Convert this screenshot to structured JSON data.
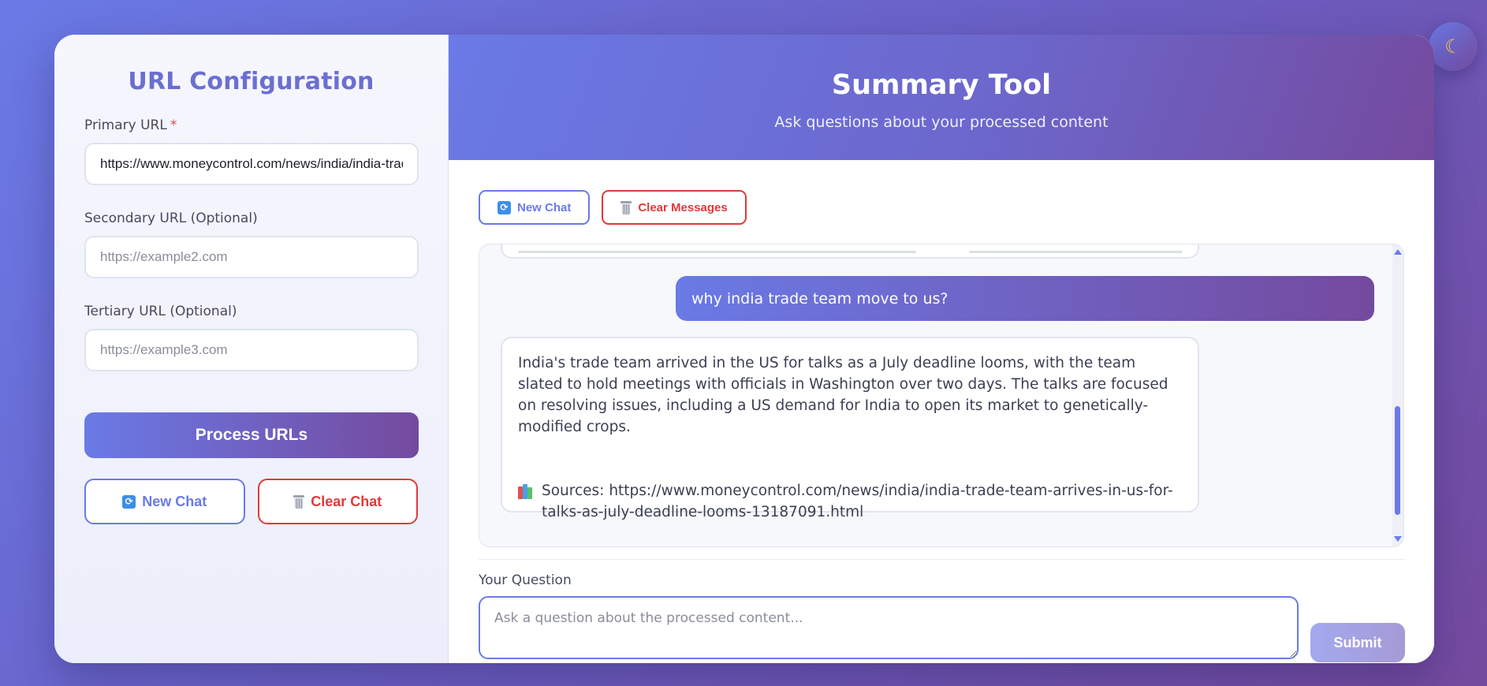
{
  "sidebar": {
    "title": "URL Configuration",
    "primary": {
      "label": "Primary URL",
      "required_mark": "*",
      "value": "https://www.moneycontrol.com/news/india/india-trade-team-arrives-in-us-for-talks-as-july-deadline-looms-13187091.html",
      "placeholder": ""
    },
    "secondary": {
      "label": "Secondary URL (Optional)",
      "value": "",
      "placeholder": "https://example2.com"
    },
    "tertiary": {
      "label": "Tertiary URL (Optional)",
      "value": "",
      "placeholder": "https://example3.com"
    },
    "process_label": "Process URLs",
    "new_chat_label": "New Chat",
    "clear_chat_label": "Clear Chat"
  },
  "header": {
    "title": "Summary Tool",
    "subtitle": "Ask questions about your processed content"
  },
  "toolbar": {
    "new_chat_label": "New Chat",
    "clear_messages_label": "Clear Messages"
  },
  "chat": {
    "user_message": "why india trade team move to us?",
    "bot_message": "India's trade team arrived in the US for talks as a July deadline looms, with the team slated to hold meetings with officials in Washington over two days. The talks are focused on resolving issues, including a US demand for India to open its market to genetically-modified crops.",
    "sources_label": "Sources:",
    "sources_url": "https://www.moneycontrol.com/news/india/india-trade-team-arrives-in-us-for-talks-as-july-deadline-looms-13187091.html"
  },
  "question": {
    "label": "Your Question",
    "placeholder": "Ask a question about the processed content...",
    "value": "",
    "submit_label": "Submit"
  },
  "icons": {
    "theme_toggle": "moon-icon",
    "new_chat": "refresh-icon",
    "clear": "trash-icon",
    "sources": "books-icon"
  },
  "colors": {
    "accent": "#6a7ae6",
    "accent_end": "#744a9e",
    "danger": "#e03a3a"
  }
}
